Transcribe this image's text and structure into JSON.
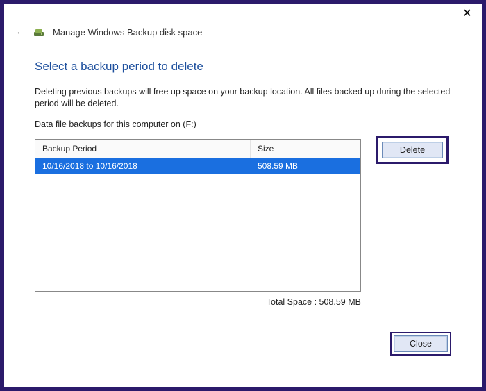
{
  "window": {
    "title": "Manage Windows Backup disk space"
  },
  "page": {
    "heading": "Select a backup period to delete",
    "description": "Deleting previous backups will free up space on your backup location. All files backed up during the selected period will be deleted.",
    "subheading": "Data file backups for this computer on (F:)"
  },
  "list": {
    "headers": {
      "period": "Backup Period",
      "size": "Size"
    },
    "rows": [
      {
        "period": "10/16/2018 to 10/16/2018",
        "size": "508.59 MB"
      }
    ]
  },
  "buttons": {
    "delete": "Delete",
    "close": "Close"
  },
  "total": {
    "label": "Total Space :",
    "value": "508.59 MB"
  }
}
